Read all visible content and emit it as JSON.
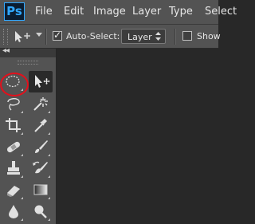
{
  "app": {
    "logo_text": "Ps"
  },
  "menu": {
    "items": [
      "File",
      "Edit",
      "Image",
      "Layer",
      "Type",
      "Select"
    ]
  },
  "options": {
    "auto_select_label": "Auto-Select:",
    "auto_select_checked": true,
    "layer_select_value": "Layer",
    "show_label": "Show",
    "show_checked": false
  },
  "tools": [
    {
      "name": "ellipse-marquee-tool",
      "active": true
    },
    {
      "name": "move-tool",
      "active": false
    },
    {
      "name": "lasso-tool",
      "active": false
    },
    {
      "name": "magic-wand-tool",
      "active": false
    },
    {
      "name": "crop-tool",
      "active": false
    },
    {
      "name": "eyedropper-tool",
      "active": false
    },
    {
      "name": "spot-healing-brush-tool",
      "active": false
    },
    {
      "name": "brush-tool",
      "active": false
    },
    {
      "name": "clone-stamp-tool",
      "active": false
    },
    {
      "name": "history-brush-tool",
      "active": false
    },
    {
      "name": "eraser-tool",
      "active": false
    },
    {
      "name": "gradient-tool",
      "active": false
    },
    {
      "name": "blur-tool",
      "active": false
    },
    {
      "name": "dodge-tool",
      "active": false
    }
  ],
  "colors": {
    "menu_bg": "#535353",
    "canvas_bg": "#282828",
    "brand": "#31a8ff",
    "highlight": "#e3101c"
  }
}
